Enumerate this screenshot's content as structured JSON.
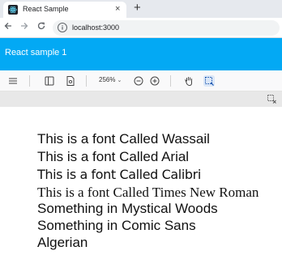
{
  "browser": {
    "tab_title": "React Sample",
    "tab_close": "×",
    "new_tab": "+",
    "url": "localhost:3000",
    "nav_icons": [
      "back-arrow-icon",
      "forward-arrow-icon",
      "reload-icon",
      "site-info-icon"
    ]
  },
  "app": {
    "title": "React sample 1",
    "accent_color": "#03a9f4"
  },
  "toolbar": {
    "zoom_label": "256%",
    "zoom_chevron": "⌄",
    "icons": [
      "menu-icon",
      "sidebar-icon",
      "page-properties-icon",
      "zoom-out-icon",
      "zoom-in-icon",
      "hand-tool-icon",
      "marquee-select-icon",
      "selection-clear-icon"
    ]
  },
  "document": {
    "lines": [
      "This is a font Called Wassail",
      "This is a font Called Arial",
      "This is a font Called Calibri",
      "This is a font Called Times New Roman",
      "Something in Mystical Woods",
      "Something in Comic Sans",
      "Algerian"
    ]
  }
}
